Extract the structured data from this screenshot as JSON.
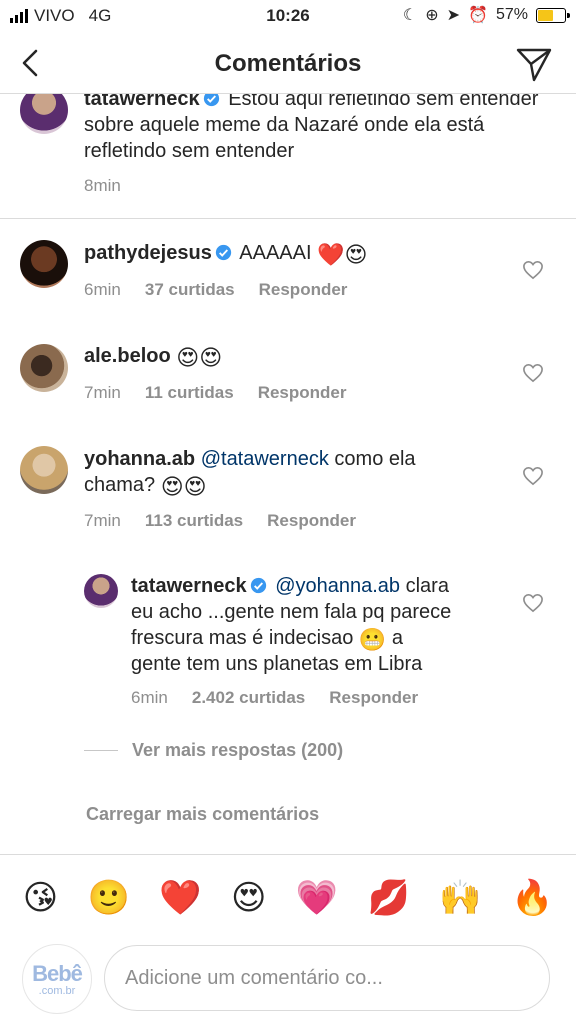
{
  "status_bar": {
    "carrier": "VIVO",
    "network": "4G",
    "time": "10:26",
    "battery": "57%",
    "battery_level": 0.57,
    "battery_color": "#f5c518"
  },
  "header": {
    "title": "Comentários",
    "back_icon": "chevron-left-icon",
    "send_icon": "direct-send-icon"
  },
  "comments": [
    {
      "username": "tatawerneck",
      "verified": true,
      "text": "Estou aqui refletindo sem entender sobre aquele meme da Nazaré onde ela está refletindo sem entender",
      "time": "8min"
    },
    {
      "username": "pathydejesus",
      "verified": true,
      "text": "AAAAAI",
      "emojis": "❤️😍",
      "time": "6min",
      "likes": "37 curtidas",
      "reply": "Responder"
    },
    {
      "username": "ale.beloo",
      "verified": false,
      "text": "",
      "emojis": "😍😍",
      "time": "7min",
      "likes": "11 curtidas",
      "reply": "Responder"
    },
    {
      "username": "yohanna.ab",
      "verified": false,
      "mention": "@tatawerneck",
      "text_line1": "como ela",
      "text_line2": "chama?",
      "emojis": "😍😍",
      "time": "7min",
      "likes": "113 curtidas",
      "reply": "Responder"
    }
  ],
  "reply": {
    "username": "tatawerneck",
    "verified": true,
    "mention": "@yohanna.ab",
    "line1": "clara",
    "line2": "eu acho ...gente nem fala pq parece",
    "line3": "frescura mas é indecisao",
    "line3_emoji": "😬",
    "line3_end": "a",
    "line4": "gente tem uns planetas em Libra",
    "time": "6min",
    "likes": "2.402 curtidas",
    "reply": "Responder"
  },
  "view_more_replies": "Ver mais respostas (200)",
  "load_more": "Carregar mais comentários",
  "emoji_bar": [
    "😘",
    "🙂",
    "❤️",
    "😍",
    "💗",
    "💋",
    "🙌",
    "🔥"
  ],
  "input": {
    "placeholder": "Adicione um comentário co...",
    "watermark": "Bebê",
    "watermark_sub": ".com.br"
  },
  "colors": {
    "verified": "#3897f0",
    "heart_red": "#ed4956",
    "mention": "#003569",
    "secondary_text": "#8e8e8e"
  }
}
